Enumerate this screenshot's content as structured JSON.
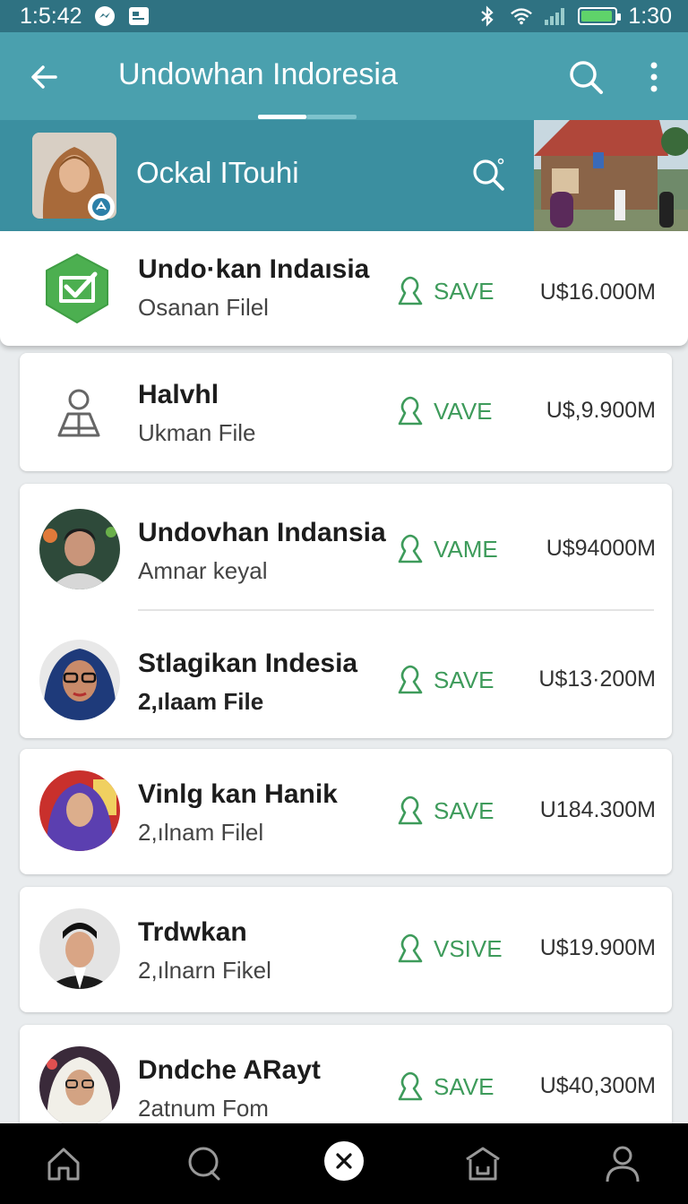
{
  "status_bar": {
    "time": "1:5:42",
    "right_time": "1:30",
    "battery_level": 0.95,
    "icons": [
      "messenger-icon",
      "gallery-icon",
      "bluetooth-icon",
      "wifi-icon",
      "signal-icon",
      "battery-icon"
    ]
  },
  "app_bar": {
    "title": "Undowhan Indoresia",
    "icons": [
      "back-arrow-icon",
      "search-icon",
      "more-vert-icon"
    ]
  },
  "profile": {
    "name": "Ockal ITouhi",
    "icons": [
      "search-icon"
    ]
  },
  "colors": {
    "status_bar": "#2f7282",
    "app_bar": "#4aa0ae",
    "profile_bar": "#3b8fa0",
    "accent_green": "#3e9b5b",
    "background": "#e9ecee",
    "bottom_nav": "#000000"
  },
  "items": [
    {
      "title": "Undo·kan Indaısia",
      "subtitle": "Osanan Filel",
      "action": "SAVE",
      "price": "U$16.000M",
      "icon": "shield-check-icon"
    },
    {
      "title": "Halvhl",
      "subtitle": "Ukman File",
      "action": "VAVE",
      "price": "U$,9.900M",
      "icon": "user-outline-icon"
    },
    {
      "title": "Undovhan Indansia",
      "subtitle": "Amnar  keyal",
      "action": "VAME",
      "price": "U$94000M",
      "icon": "avatar"
    },
    {
      "title": "Stlagikan Indesia",
      "subtitle": "2,ılaam File",
      "action": "SAVE",
      "price": "U$13·200M",
      "icon": "avatar"
    },
    {
      "title": "Vinlg kan Hanik",
      "subtitle": "2,ılnam Filel",
      "action": "SAVE",
      "price": "U184.300M",
      "icon": "avatar"
    },
    {
      "title": "Trdwkan",
      "subtitle": "2,ılnarn Fikel",
      "action": "VSIVE",
      "price": "U$19.900M",
      "icon": "avatar"
    },
    {
      "title": "Dndche ARayt",
      "subtitle": "2atnum Fom",
      "action": "SAVE",
      "price": "U$40,300M",
      "icon": "avatar"
    }
  ],
  "bottom_nav": {
    "icons": [
      "home-icon",
      "chat-icon",
      "close-icon",
      "store-icon",
      "profile-icon"
    ]
  }
}
